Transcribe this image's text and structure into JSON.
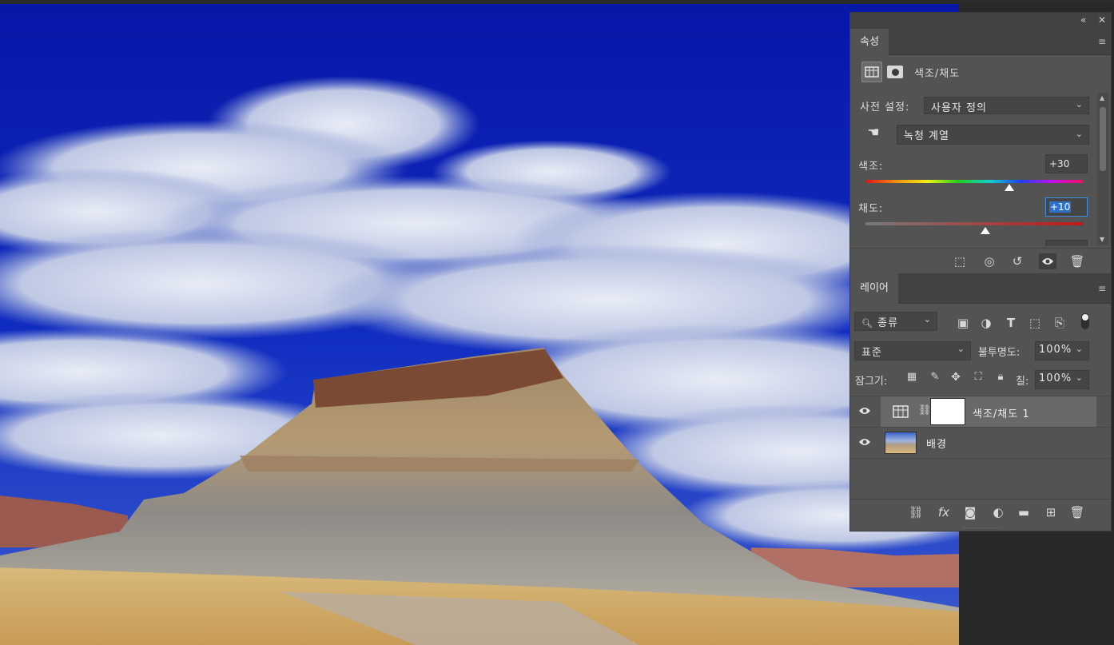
{
  "window_controls": {
    "collapse": "«",
    "close": "✕"
  },
  "properties": {
    "tab_label": "속성",
    "adjustment_title": "색조/채도",
    "preset_label": "사전 설정:",
    "preset_value": "사용자 정의",
    "channel_value": "녹청 계열",
    "hue_label": "색조:",
    "hue_value": "+30",
    "saturation_label": "채도:",
    "saturation_value": "+10",
    "hue_thumb_level": 0.66,
    "saturation_thumb_level": 0.55
  },
  "layers": {
    "tab_label": "레이어",
    "filter_kind": "종류",
    "blend_mode": "표준",
    "opacity_label": "불투명도:",
    "opacity_value": "100%",
    "lock_label": "잠그기:",
    "fill_label": "칠:",
    "fill_value": "100%",
    "items": [
      {
        "name": "색조/채도 1",
        "selected": true
      },
      {
        "name": "배경",
        "selected": false
      }
    ]
  },
  "colors": {
    "accent": "#2d72c8",
    "panel_bg": "#535353",
    "selected_layer": "#696969"
  }
}
